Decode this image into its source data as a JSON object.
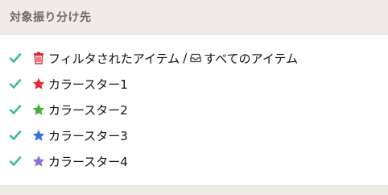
{
  "panel": {
    "title": "対象振り分け先"
  },
  "targets": [
    {
      "checked": true,
      "icon": "trash-icon",
      "label": "フィルタされたアイテム",
      "separator": "/",
      "secondary_icon": "inbox-icon",
      "secondary_label": "すべてのアイテム"
    },
    {
      "checked": true,
      "icon": "star-icon",
      "label": "カラースター1",
      "star_color": "#e8222f"
    },
    {
      "checked": true,
      "icon": "star-icon",
      "label": "カラースター2",
      "star_color": "#3fb13a"
    },
    {
      "checked": true,
      "icon": "star-icon",
      "label": "カラースター3",
      "star_color": "#3b70d8"
    },
    {
      "checked": true,
      "icon": "star-icon",
      "label": "カラースター4",
      "star_color": "#8b6fd6"
    }
  ],
  "colors": {
    "check": "#3ebf82",
    "trash": "#d8282c",
    "inbox": "#444444",
    "header_bg": "#eeece7",
    "header_text": "#6d6a63"
  }
}
